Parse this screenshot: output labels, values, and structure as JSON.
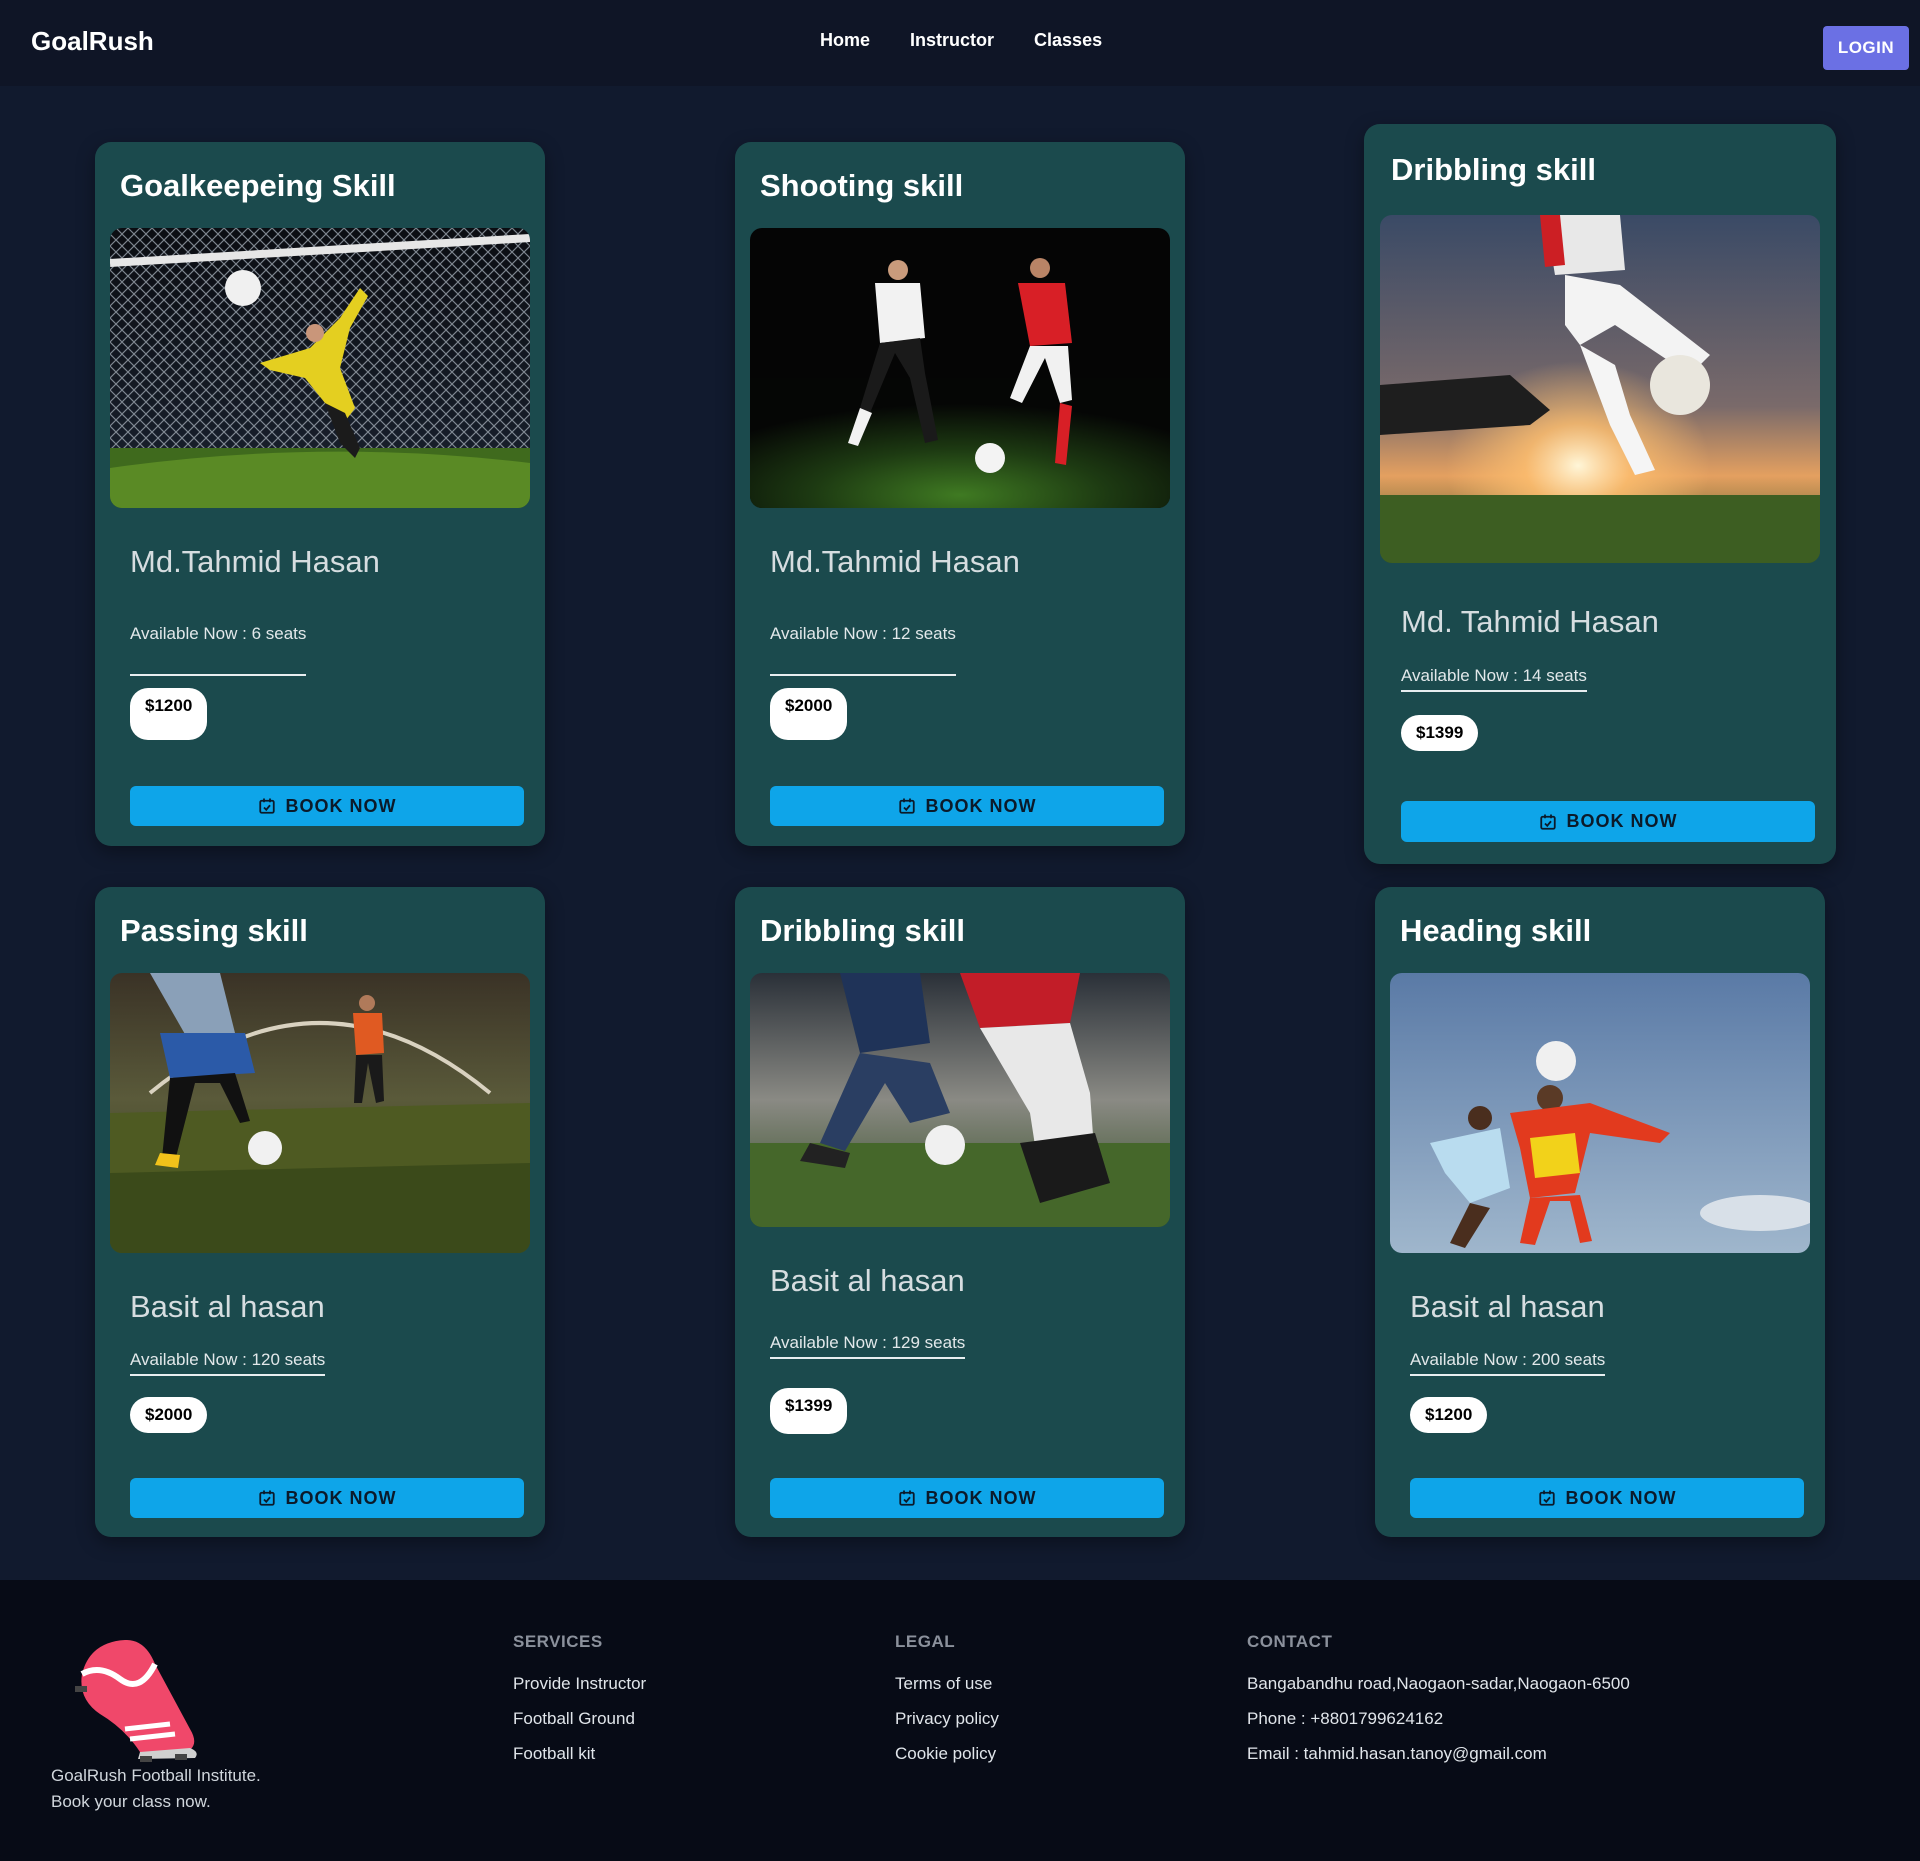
{
  "navbar": {
    "brand": "GoalRush",
    "links": [
      "Home",
      "Instructor",
      "Classes"
    ],
    "login_label": "LOGIN"
  },
  "cards": [
    {
      "title": "Goalkeepeing Skill",
      "image": "goalkeeper-diving-photo",
      "instructor": "Md.Tahmid Hasan",
      "seats": "Available Now : 6 seats",
      "price": "$1200",
      "button": "BOOK NOW"
    },
    {
      "title": "Shooting skill",
      "image": "two-players-shooting-photo",
      "instructor": "Md.Tahmid Hasan",
      "seats": "Available Now : 12 seats",
      "price": "$2000",
      "button": "BOOK NOW"
    },
    {
      "title": "Dribbling skill",
      "image": "player-kicking-ball-sunset-photo",
      "instructor": "Md. Tahmid Hasan",
      "seats": "Available Now : 14 seats",
      "price": "$1399",
      "button": "BOOK NOW"
    },
    {
      "title": "Passing skill",
      "image": "indoor-passing-photo",
      "instructor": "Basit al hasan",
      "seats": "Available Now : 120 seats",
      "price": "$2000",
      "button": "BOOK NOW"
    },
    {
      "title": "Dribbling skill",
      "image": "dribbling-stadium-photo",
      "instructor": "Basit al hasan",
      "seats": "Available Now : 129 seats",
      "price": "$1399",
      "button": "BOOK NOW"
    },
    {
      "title": "Heading skill",
      "image": "kids-heading-ball-photo",
      "instructor": "Basit al hasan",
      "seats": "Available Now : 200 seats",
      "price": "$1200",
      "button": "BOOK NOW"
    }
  ],
  "footer": {
    "logo": "football-boot-logo",
    "tagline_line1": "GoalRush Football Institute.",
    "tagline_line2": "Book your class now.",
    "services": {
      "heading": "SERVICES",
      "items": [
        "Provide Instructor",
        "Football Ground",
        "Football kit"
      ]
    },
    "legal": {
      "heading": "LEGAL",
      "items": [
        "Terms of use",
        "Privacy policy",
        "Cookie policy"
      ]
    },
    "contact": {
      "heading": "CONTACT",
      "address": "Bangabandhu road,Naogaon-sadar,Naogaon-6500",
      "phone": "Phone : +8801799624162",
      "email": "Email : tahmid.hasan.tanoy@gmail.com"
    }
  },
  "colors": {
    "page_bg": "#111a2e",
    "nav_bg": "#0f1526",
    "card_bg": "#1b4a4d",
    "book_button": "#0ea5e9",
    "login_button": "#6b70e4",
    "footer_bg": "#070b16"
  }
}
